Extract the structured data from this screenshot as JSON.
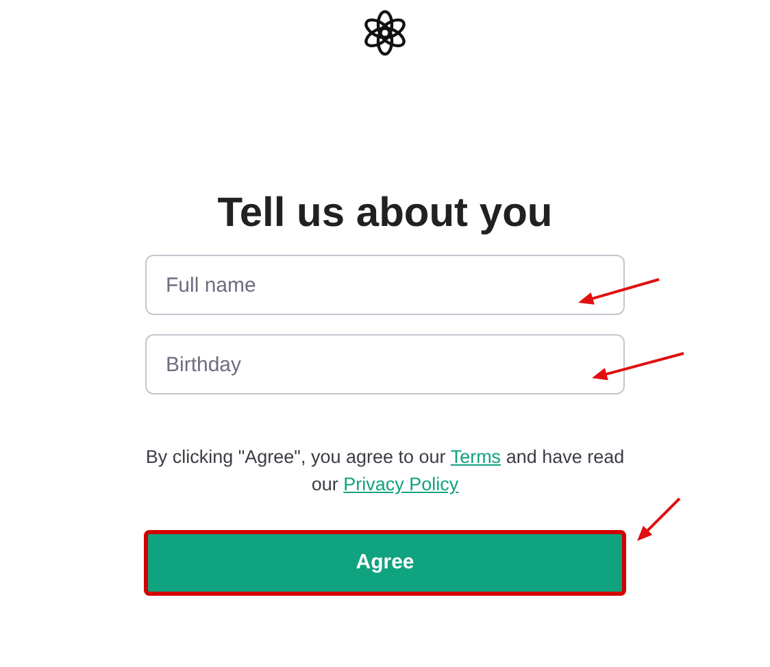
{
  "heading": "Tell us about you",
  "fields": [
    {
      "placeholder": "Full name"
    },
    {
      "placeholder": "Birthday"
    }
  ],
  "consent": [
    {
      "kind": "text",
      "text": "By clicking \"Agree\", you agree to our "
    },
    {
      "kind": "link",
      "text": "Terms"
    },
    {
      "kind": "text",
      "text": " and have read our "
    },
    {
      "kind": "link",
      "text": "Privacy Policy"
    }
  ],
  "agree_button": {
    "label": "Agree",
    "highlighted": true
  }
}
